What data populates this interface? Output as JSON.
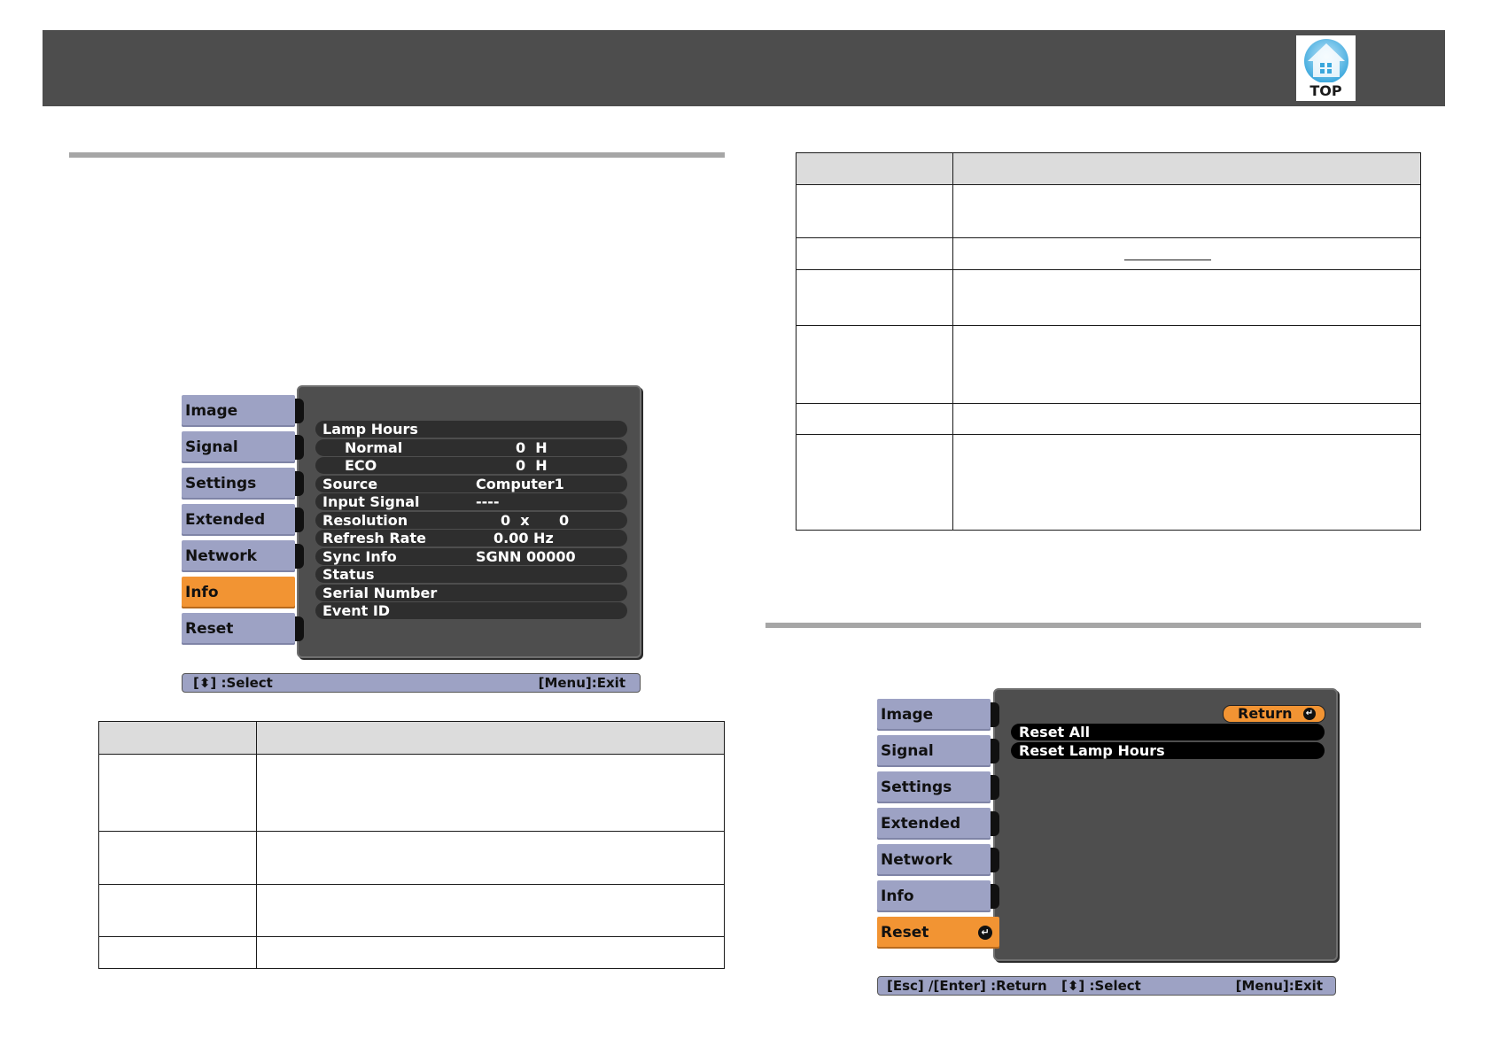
{
  "header": {
    "top_label": "TOP"
  },
  "info_menu": {
    "tabs": [
      "Image",
      "Signal",
      "Settings",
      "Extended",
      "Network",
      "Info",
      "Reset"
    ],
    "active_tab": "Info",
    "rows": [
      {
        "label": "Lamp Hours",
        "value": ""
      },
      {
        "label": "Normal",
        "value": "0  H"
      },
      {
        "label": "ECO",
        "value": "0  H"
      },
      {
        "label": "Source",
        "value": "Computer1"
      },
      {
        "label": "Input Signal",
        "value": "----"
      },
      {
        "label": "Resolution",
        "value": "0  x      0"
      },
      {
        "label": "Refresh Rate",
        "value": "0.00 Hz"
      },
      {
        "label": "Sync Info",
        "value": "SGNN 00000"
      },
      {
        "label": "Status",
        "value": ""
      },
      {
        "label": "Serial Number",
        "value": ""
      },
      {
        "label": "Event ID",
        "value": ""
      }
    ],
    "footer": {
      "select": "[⬍] :Select",
      "exit": "[Menu]:Exit"
    }
  },
  "reset_menu": {
    "tabs": [
      "Image",
      "Signal",
      "Settings",
      "Extended",
      "Network",
      "Info",
      "Reset"
    ],
    "active_tab": "Reset",
    "return_label": "Return",
    "items": [
      "Reset All",
      "Reset Lamp Hours"
    ],
    "footer": {
      "return": "[Esc] /[Enter] :Return",
      "select": "[⬍] :Select",
      "exit": "[Menu]:Exit"
    }
  },
  "colors": {
    "header_bar": "#4d4d4d",
    "menu_tab": "#9da2c4",
    "active_tab": "#f29433",
    "panel": "#4e4e4e"
  },
  "icons": {
    "top": "top-house-icon",
    "enter": "enter-icon"
  }
}
